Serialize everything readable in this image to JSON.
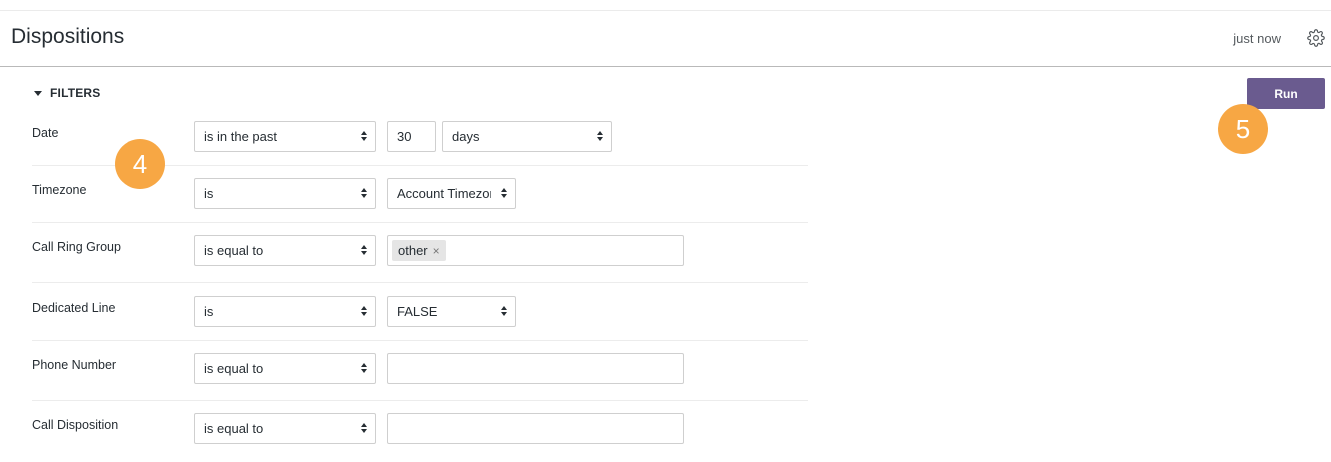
{
  "header": {
    "title": "Dispositions",
    "updated": "just now",
    "settings_icon": "gear-icon"
  },
  "filters": {
    "toggle_label": "FILTERS",
    "toggle_icon": "caret-down-icon",
    "run_label": "Run",
    "rows": [
      {
        "label": "Date",
        "operator": "is in the past",
        "value": "30",
        "unit": "days"
      },
      {
        "label": "Timezone",
        "operator": "is",
        "value": "Account Timezone"
      },
      {
        "label": "Call Ring Group",
        "operator": "is equal to",
        "tag": "other",
        "tag_remove": "×"
      },
      {
        "label": "Dedicated Line",
        "operator": "is",
        "value": "FALSE"
      },
      {
        "label": "Phone Number",
        "operator": "is equal to",
        "value": ""
      },
      {
        "label": "Call Disposition",
        "operator": "is equal to",
        "value": ""
      }
    ]
  },
  "annotations": {
    "step_4": "4",
    "step_5": "5",
    "badge_color": "#f7a744"
  },
  "colors": {
    "run_button": "#6a5b8f"
  }
}
